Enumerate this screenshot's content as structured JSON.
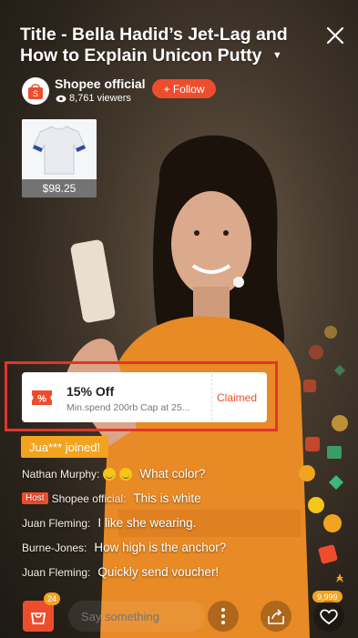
{
  "header": {
    "title": "Title - Bella Hadid’s Jet-Lag and How to Explain Unicon Putty",
    "caret_icon": "caret-down-icon",
    "close_icon": "close-icon"
  },
  "shop": {
    "name": "Shopee official",
    "viewers": "8,761 viewers",
    "follow_label": "+ Follow",
    "avatar_icon": "shopee-bag-icon"
  },
  "product": {
    "price": "$98.25",
    "image_icon": "tshirt-icon"
  },
  "voucher": {
    "title": "15% Off",
    "subtitle": "Min.spend 200rb Cap at 25...",
    "status": "Claimed",
    "icon": "voucher-percent-icon"
  },
  "joined": {
    "text": "Jua*** joined!"
  },
  "chat": [
    {
      "user": "Nathan Murphy:",
      "message": "What color?",
      "host": false,
      "emoji": true
    },
    {
      "user": "Shopee official:",
      "message": "This is white",
      "host": true,
      "host_label": "Host"
    },
    {
      "user": "Juan Fleming:",
      "message": "I like she wearing."
    },
    {
      "user": "Burne-Jones:",
      "message": "How high is the anchor?"
    },
    {
      "user": "Juan Fleming:",
      "message": "Quickly send voucher!"
    }
  ],
  "bottom": {
    "cart_count": "24",
    "input_placeholder": "Say something",
    "likes": "9,999",
    "icons": [
      "shopping-bag-icon",
      "more-vertical-icon",
      "share-icon",
      "heart-icon"
    ]
  },
  "colors": {
    "brand": "#ee4d2d",
    "badge": "#f2a31f",
    "highlight": "#e1352b"
  }
}
